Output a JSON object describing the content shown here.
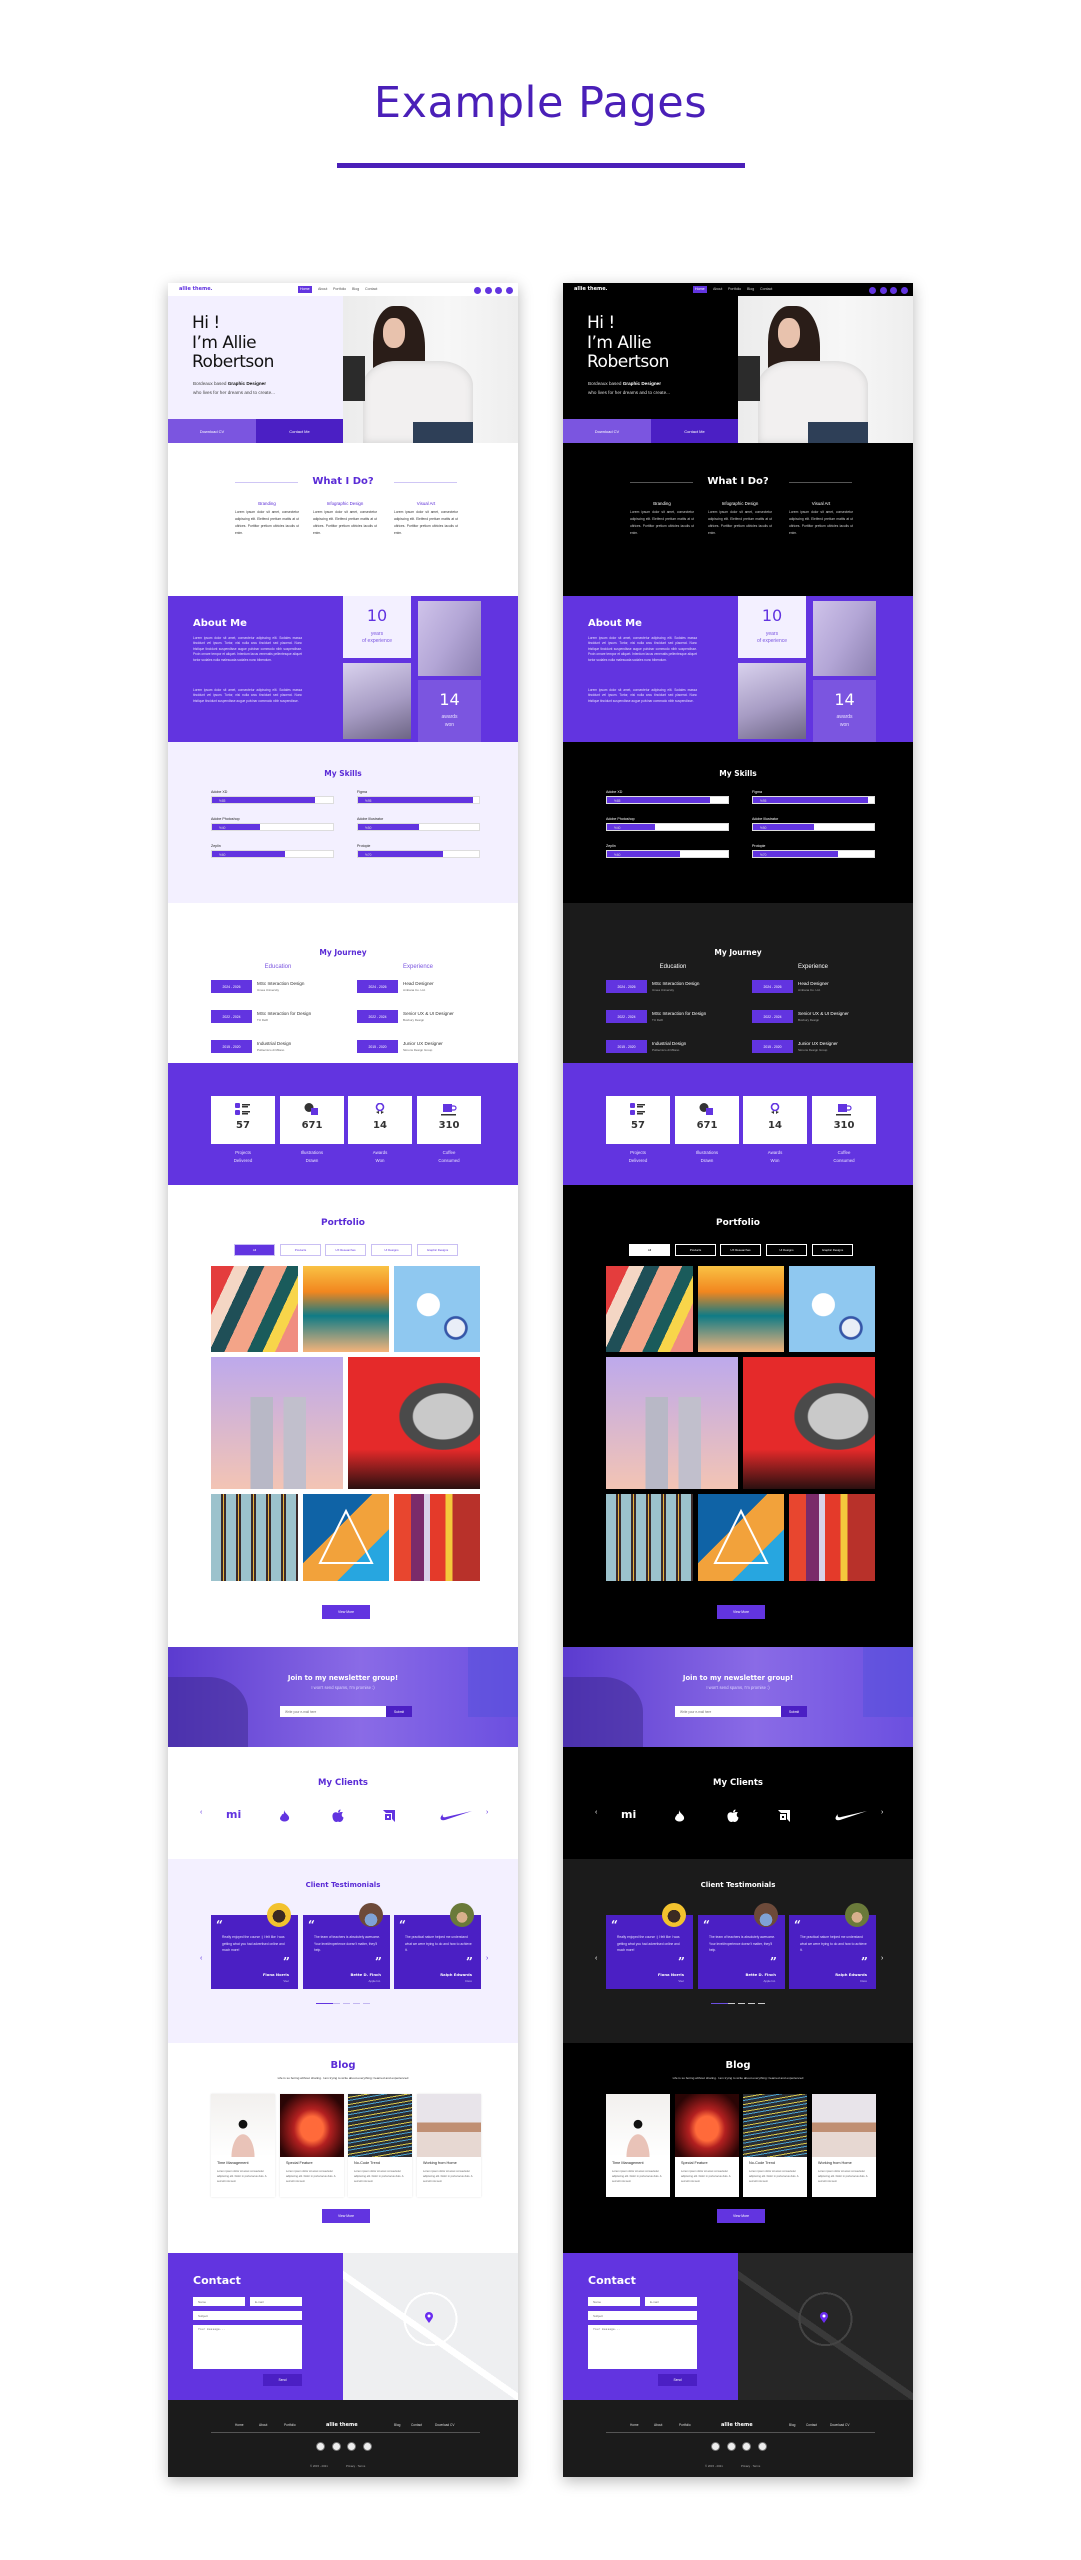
{
  "heading": {
    "title": "Example Pages"
  },
  "colors": {
    "accent": "#6234e0",
    "accent_dark": "#4b1fc4",
    "accent_mid": "#7b55e0",
    "accent_light": "#f3f0ff",
    "heading": "#4a1fb8",
    "footer_bg": "#1b1b1b"
  },
  "variants": [
    {
      "theme": "light"
    },
    {
      "theme": "dark"
    }
  ],
  "site": {
    "nav": {
      "logo": "allie theme.",
      "items": [
        "Home",
        "About",
        "Portfolio",
        "Blog",
        "Contact"
      ],
      "active": "Home",
      "social": [
        "behance-icon",
        "dribbble-icon",
        "pinterest-icon",
        "linkedin-icon"
      ]
    },
    "hero": {
      "line1": "Hi !",
      "line2": "I’m Allie",
      "line3": "Robertson",
      "sub_prefix": "Bordeaux based ",
      "sub_bold": "Graphic Designer",
      "sub_line2": "who lives for her dreams and to create...",
      "download": "Download CV",
      "contact": "Contact Me"
    },
    "services": {
      "title": "What I Do?",
      "items": [
        {
          "title": "Branding",
          "text": "Lorem ipsum dolor sit amet, consectetur adipiscing elit. Eleifend pretium mattis at ut ultrices. Porttitor pretium ultricies iaculis ut enim."
        },
        {
          "title": "Infographic Design",
          "text": "Lorem ipsum dolor sit amet, consectetur adipiscing elit. Eleifend pretium mattis at ut ultrices. Porttitor pretium ultricies iaculis ut enim."
        },
        {
          "title": "Visual Art",
          "text": "Lorem ipsum dolor sit amet, consectetur adipiscing elit. Eleifend pretium mattis at ut ultrices. Porttitor pretium ultricies iaculis ut enim."
        }
      ]
    },
    "about": {
      "title": "About Me",
      "p1": "Lorem ipsum dolor sit amet, consectetur adipiscing elit. Sodales massa tincidunt vel ipsum. Tortor, nisi nulla arcu tincidunt sed placerat. Nunc tristique tincidunt suspendisse augue pulvinar commodo nibh suspendisse. Proin ornare tempor et aliquet. Interdum lacus venenatis pellentesque aliquet tortor sodales nulla malesuada sodales nunc bibendum.",
      "p2": "Lorem ipsum dolor sit amet, consectetur adipiscing elit. Sodales massa tincidunt vel ipsum. Tortor, nisi nulla arcu tincidunt sed placerat. Nunc tristique tincidunt suspendisse augue pulvinar commodo nibh suspendisse.",
      "years": "10",
      "years_label1": "years",
      "years_label2": "of experience",
      "awards": "14",
      "awards_label1": "awards",
      "awards_label2": "won"
    },
    "skills": {
      "title": "My Skills",
      "items": [
        {
          "name": "Adobe XD",
          "label": "%85",
          "value": 85
        },
        {
          "name": "Figma",
          "label": "%95",
          "value": 95
        },
        {
          "name": "Adobe Photoshop",
          "label": "%40",
          "value": 40
        },
        {
          "name": "Adobe Illustrator",
          "label": "%50",
          "value": 50
        },
        {
          "name": "Zeplin",
          "label": "%60",
          "value": 60
        },
        {
          "name": "Protopie",
          "label": "%70",
          "value": 70
        }
      ]
    },
    "journey": {
      "title": "My Journey",
      "education_title": "Education",
      "experience_title": "Experience",
      "education": [
        {
          "years": "2024 - 2026",
          "title": "MSc Interaction Design",
          "place": "Umea University"
        },
        {
          "years": "2022 - 2024",
          "title": "MSc Interaction for Design",
          "place": "TU Delft"
        },
        {
          "years": "2015 - 2020",
          "title": "Industrial Design",
          "place": "Politecnico di Milano"
        }
      ],
      "experience": [
        {
          "years": "2024 - 2026",
          "title": "Head Designer",
          "place": "Ambana Co. Ltd."
        },
        {
          "years": "2022 - 2024",
          "title": "Senior UX & UI Designer",
          "place": "Buxbury Design"
        },
        {
          "years": "2015 - 2020",
          "title": "Junior UX Designer",
          "place": "Simons Design Group"
        }
      ]
    },
    "stats": [
      {
        "icon": "checklist-icon",
        "value": "57",
        "label1": "Projects",
        "label2": "Delivered"
      },
      {
        "icon": "shapes-icon",
        "value": "671",
        "label1": "Illustrations",
        "label2": "Drawn"
      },
      {
        "icon": "award-icon",
        "value": "14",
        "label1": "Awards",
        "label2": "Won"
      },
      {
        "icon": "coffee-cup-icon",
        "value": "310",
        "label1": "Coffee",
        "label2": "Consumed"
      }
    ],
    "portfolio": {
      "title": "Portfolio",
      "filters": [
        "All",
        "Products",
        "UX Researches",
        "UI Designs",
        "Graphic Designs"
      ],
      "active_filter": "All",
      "view_more": "View More"
    },
    "newsletter": {
      "title": "Join to my newsletter group!",
      "subtitle": "I won't send spams, I'm promise :)",
      "placeholder": "Write your e-mail here",
      "submit": "Submit"
    },
    "clients": {
      "title": "My Clients",
      "logos": [
        "xiaomi-logo",
        "tinder-logo",
        "apple-logo",
        "amd-logo",
        "nike-logo"
      ],
      "xiaomi_text": "mi"
    },
    "testimonials": {
      "title": "Client Testimonials",
      "items": [
        {
          "text": "Really enjoyed the course :) I felt like I was getting what you had advertised online and much more!",
          "name": "Fiona Norris",
          "company": "Vtec"
        },
        {
          "text": "The team of teachers is absolutely awesome. Your level/experience doesn't matter, they'll help.",
          "name": "Bette D. Finch",
          "company": "Apple Inc."
        },
        {
          "text": "The practical nature helped me understand what we were trying to do and how to achieve it.",
          "name": "Ralph Edwards",
          "company": "Cisco"
        }
      ],
      "active_dot": 0,
      "dot_count": 5
    },
    "blog": {
      "title": "Blog",
      "subtitle": "Life is so boring without sharing. I am trying to write about everything I learned and experienced",
      "posts": [
        {
          "title": "Time Management",
          "text": "Lorem ipsum dolor sit amet consectetur adipiscing elit. Dolor in porta lacus duis. A sed elit nisi sed."
        },
        {
          "title": "Special Feature",
          "text": "Lorem ipsum dolor sit amet consectetur adipiscing elit. Dolor in porta lacus duis. A sed elit nisi sed."
        },
        {
          "title": "No-Code Trend",
          "text": "Lorem ipsum dolor sit amet consectetur adipiscing elit. Dolor in porta lacus duis. A sed elit nisi sed."
        },
        {
          "title": "Working from Home",
          "text": "Lorem ipsum dolor sit amet consectetur adipiscing elit. Dolor in porta lacus duis. A sed elit nisi sed."
        }
      ],
      "view_more": "View More"
    },
    "contact": {
      "title": "Contact",
      "name_ph": "Name",
      "email_ph": "E-mail",
      "subject_ph": "Subject",
      "message_ph": "Your message...",
      "send": "Send"
    },
    "footer": {
      "left": [
        "Home",
        "About",
        "Portfolio"
      ],
      "logo": "allie theme",
      "right": [
        "Blog",
        "Contact",
        "Download CV"
      ],
      "copyright": "© 2015 - 2021",
      "links": "Privacy · Terms"
    }
  }
}
